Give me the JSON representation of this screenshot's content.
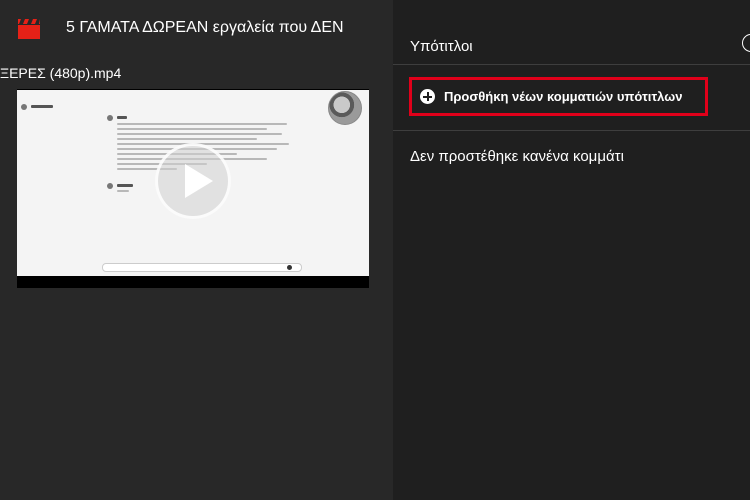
{
  "header": {
    "title": "5 ΓΑΜΑΤΑ ΔΩΡΕΑΝ εργαλεία που ΔΕΝ",
    "icon": "clapperboard-icon",
    "icon_color": "#e62117"
  },
  "video": {
    "filename": "ΞΕΡΕΣ (480p).mp4"
  },
  "subtitles_panel": {
    "title": "Υπότιτλοι",
    "add_button_label": "Προσθήκη νέων κομματιών υπότιτλων",
    "empty_message": "Δεν προστέθηκε κανένα κομμάτι",
    "highlight_color": "#e0001a"
  }
}
